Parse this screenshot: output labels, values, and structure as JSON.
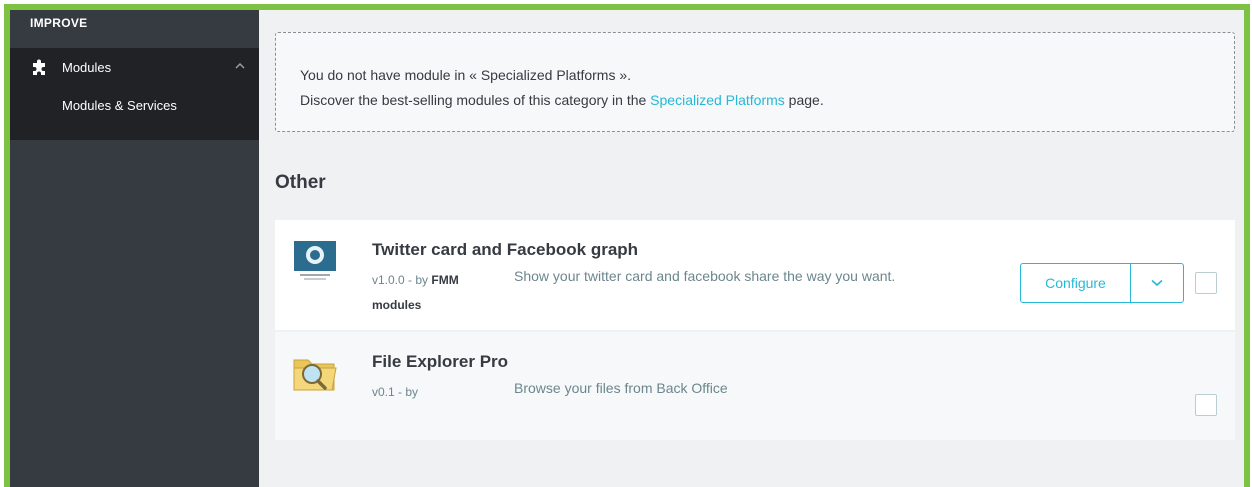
{
  "sidebar": {
    "heading": "IMPROVE",
    "menu": {
      "label": "Modules",
      "icon": "puzzle-icon",
      "expand_icon": "chevron-up-icon"
    },
    "submenu": [
      "Modules & Services"
    ]
  },
  "notice": {
    "line1": "You do not have module in « Specialized Platforms ».",
    "line2_prefix": "Discover the best-selling modules of this category in the ",
    "line2_link": "Specialized Platforms",
    "line2_suffix": " page."
  },
  "section_title": "Other",
  "modules": [
    {
      "name": "Twitter card and Facebook graph",
      "version_by": "v1.0.0 - by ",
      "author_line1": "FMM",
      "author_line2": "modules",
      "description": "Show your twitter card and facebook share the way you want.",
      "configure_label": "Configure",
      "dropdown_icon": "chevron-down-icon",
      "logo_icon": "twitter-card-logo-icon"
    },
    {
      "name": "File Explorer Pro",
      "version_by": "v0.1 - by",
      "description": "Browse your files from Back Office",
      "logo_icon": "folder-magnifier-icon"
    }
  ],
  "colors": {
    "accent": "#25b9d7",
    "sidebar": "#363a41",
    "frame": "#7dc242"
  }
}
